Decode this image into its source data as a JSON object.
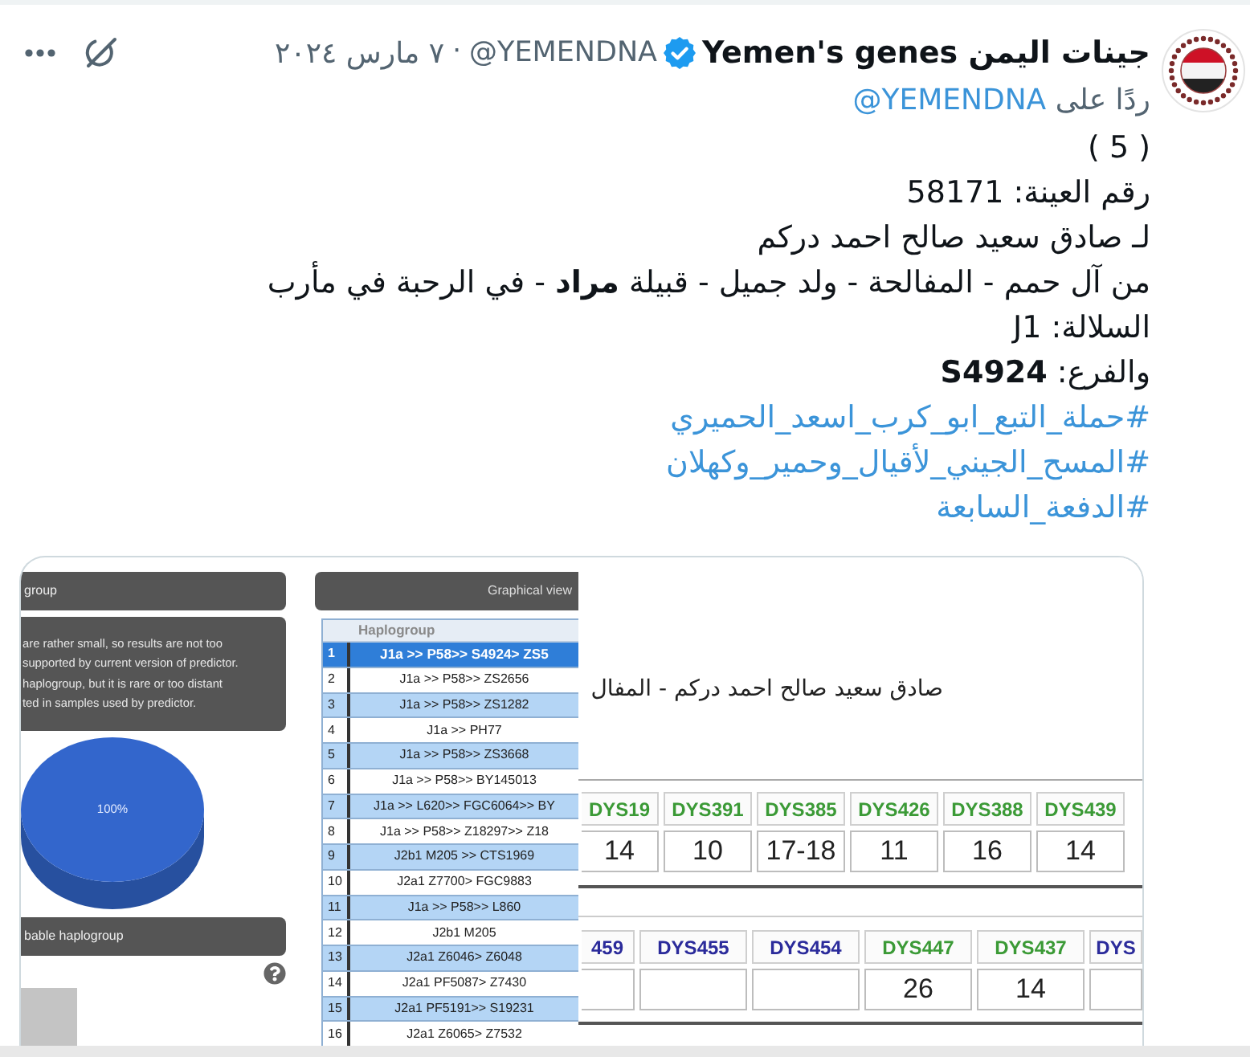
{
  "tweet": {
    "author_name": "جينات اليمن Yemen's genes",
    "verified": true,
    "handle": "@YEMENDNA",
    "separator": "·",
    "date": "٧ مارس ٢٠٢٤",
    "reply_label": "ردًا على",
    "reply_to": "@YEMENDNA",
    "body_lines": [
      "( 5 )",
      "رقم العينة: 58171",
      "لـ صادق سعيد صالح احمد دركم",
      "من آل حمم - المفالحة - ولد جميل - قبيلة **مراد** - في الرحبة في مأرب",
      "السلالة: J1",
      "والفرع: **S4924**"
    ],
    "hashtags": [
      "#حملة_التبع_ابو_كرب_اسعد_الحميري",
      "#المسح_الجيني_لأقيال_وحمير_وكهلان",
      "#الدفعة_السابعة"
    ]
  },
  "media": {
    "predictor": {
      "result_header": "group",
      "note_lines": [
        "are rather small, so results are not too",
        "supported by current version of predictor.",
        "haplogroup, but it is rare or too distant",
        "ted in samples used by predictor."
      ],
      "pie_label": "100%",
      "list_header": "bable haplogroup",
      "view_header": "Graphical view",
      "table": {
        "columns": [
          "Haplogroup"
        ],
        "rows": [
          {
            "number": "1",
            "haplogroup": "J1a >> P58>> S4924> ZS5",
            "selected": true
          },
          {
            "number": "2",
            "haplogroup": "J1a >> P58>> ZS2656",
            "selected": false
          },
          {
            "number": "3",
            "haplogroup": "J1a >> P58>> ZS1282",
            "selected": false
          },
          {
            "number": "4",
            "haplogroup": "J1a >> PH77",
            "selected": false
          },
          {
            "number": "5",
            "haplogroup": "J1a >> P58>> ZS3668",
            "selected": false
          },
          {
            "number": "6",
            "haplogroup": "J1a >> P58>> BY145013",
            "selected": false
          },
          {
            "number": "7",
            "haplogroup": "J1a >> L620>> FGC6064>> BY",
            "selected": false
          },
          {
            "number": "8",
            "haplogroup": "J1a >> P58>> Z18297>> Z18",
            "selected": false
          },
          {
            "number": "9",
            "haplogroup": "J2b1 M205 >> CTS1969",
            "selected": false
          },
          {
            "number": "10",
            "haplogroup": "J2a1 Z7700> FGC9883",
            "selected": false
          },
          {
            "number": "11",
            "haplogroup": "J1a >> P58>> L860",
            "selected": false
          },
          {
            "number": "12",
            "haplogroup": "J2b1 M205",
            "selected": false
          },
          {
            "number": "13",
            "haplogroup": "J2a1 Z6046> Z6048",
            "selected": false
          },
          {
            "number": "14",
            "haplogroup": "J2a1 PF5087> Z7430",
            "selected": false
          },
          {
            "number": "15",
            "haplogroup": "J2a1 PF5191>> S19231",
            "selected": false
          },
          {
            "number": "16",
            "haplogroup": "J2a1 Z6065> Z7532",
            "selected": false
          }
        ]
      }
    },
    "str_sheet": {
      "title": "صادق سعيد صالح احمد دركم - المفال",
      "tables": [
        {
          "markers": [
            {
              "name": "DYS19",
              "color": "#3b9a36",
              "value": "14"
            },
            {
              "name": "DYS391",
              "color": "#3b9a36",
              "value": "10"
            },
            {
              "name": "DYS385",
              "color": "#3b9a36",
              "value": "17-18"
            },
            {
              "name": "DYS426",
              "color": "#3b9a36",
              "value": "11"
            },
            {
              "name": "DYS388",
              "color": "#3b9a36",
              "value": "16"
            },
            {
              "name": "DYS439",
              "color": "#3b9a36",
              "value": "14"
            }
          ]
        },
        {
          "markers": [
            {
              "name": "459",
              "color": "#2b2b9b"
            },
            {
              "name": "DYS455",
              "color": "#2b2b9b"
            },
            {
              "name": "DYS454",
              "color": "#2b2b9b"
            },
            {
              "name": "DYS447",
              "color": "#3b9a36",
              "value": "26"
            },
            {
              "name": "DYS437",
              "color": "#3b9a36",
              "value": "14"
            },
            {
              "name": "DYS",
              "color": "#2b2b9b"
            }
          ]
        }
      ]
    }
  }
}
